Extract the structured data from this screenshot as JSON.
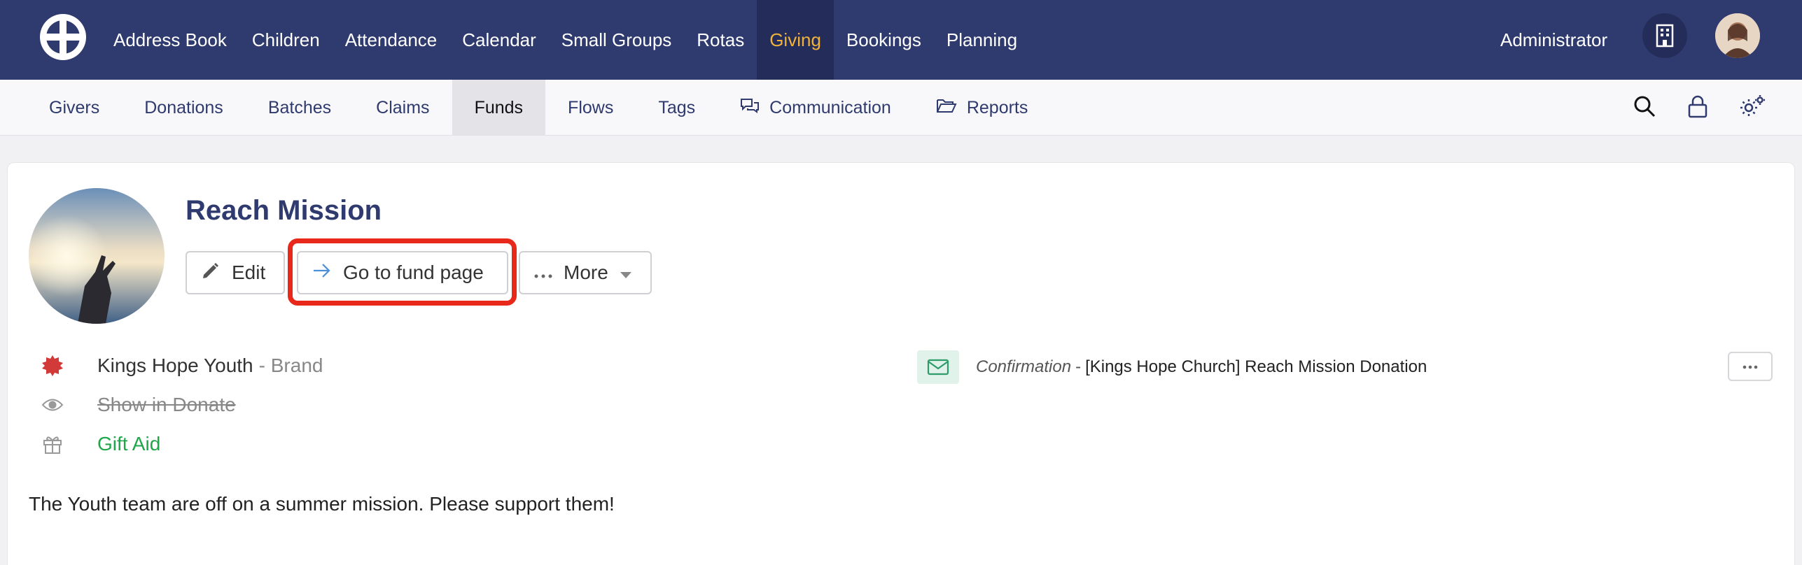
{
  "topnav": {
    "items": [
      "Address Book",
      "Children",
      "Attendance",
      "Calendar",
      "Small Groups",
      "Rotas",
      "Giving",
      "Bookings",
      "Planning"
    ],
    "active": "Giving",
    "user_label": "Administrator"
  },
  "subnav": {
    "items": [
      "Givers",
      "Donations",
      "Batches",
      "Claims",
      "Funds",
      "Flows",
      "Tags",
      "Communication",
      "Reports"
    ],
    "active": "Funds"
  },
  "fund": {
    "title": "Reach Mission",
    "buttons": {
      "edit": "Edit",
      "go": "Go to fund page",
      "more": "More"
    },
    "brand_name": "Kings Hope Youth",
    "brand_tag": "- Brand",
    "show_in_donate": "Show in Donate",
    "gift_aid": "Gift Aid",
    "confirmation_label": "Confirmation",
    "confirmation_sep": "-",
    "confirmation_text": "[Kings Hope Church] Reach Mission Donation",
    "description": "The Youth team are off on a summer mission. Please support them!"
  },
  "colors": {
    "nav_bg": "#2f3a6e",
    "active_nav": "#f0b23a",
    "highlight": "#e8281b",
    "gift_aid": "#1fa64a",
    "brand_icon": "#d23a3a"
  }
}
